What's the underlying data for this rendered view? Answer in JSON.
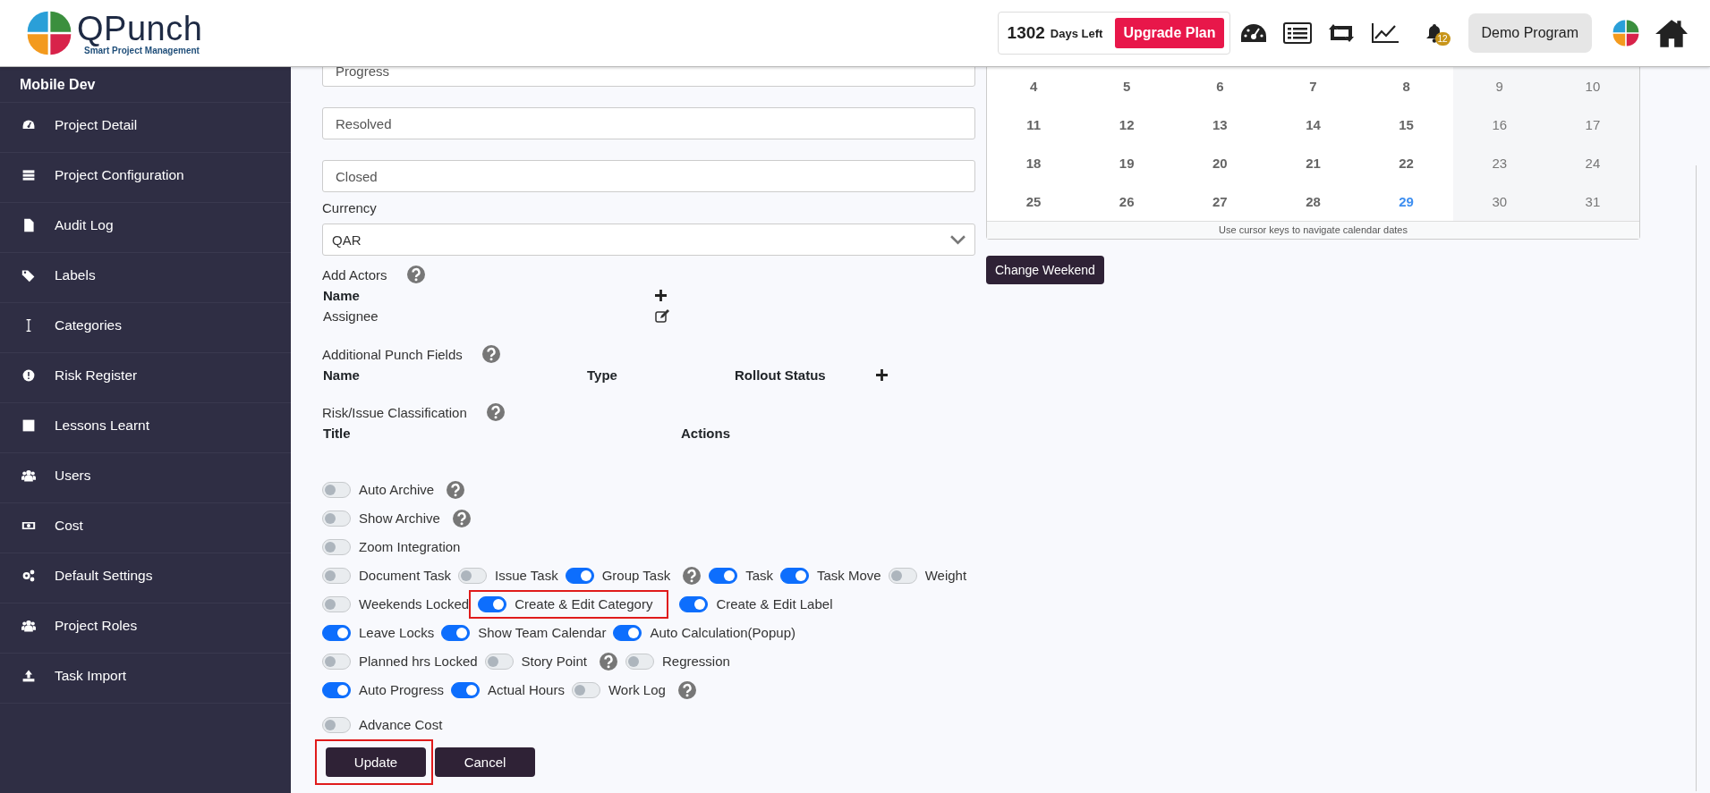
{
  "header": {
    "logo": {
      "name": "QPunch",
      "tagline": "Smart Project Management"
    },
    "days_left": {
      "count": "1302",
      "label": "Days Left"
    },
    "upgrade_button": "Upgrade Plan",
    "notification_badge": "12",
    "program_button": "Demo Program"
  },
  "sidebar": {
    "project": "Mobile Dev",
    "items": [
      {
        "label": "Project Detail"
      },
      {
        "label": "Project Configuration"
      },
      {
        "label": "Audit Log"
      },
      {
        "label": "Labels"
      },
      {
        "label": "Categories"
      },
      {
        "label": "Risk Register"
      },
      {
        "label": "Lessons Learnt"
      },
      {
        "label": "Users"
      },
      {
        "label": "Cost"
      },
      {
        "label": "Default Settings"
      },
      {
        "label": "Project Roles"
      },
      {
        "label": "Task Import"
      }
    ]
  },
  "form": {
    "status_fields": [
      "Progress",
      "Resolved",
      "Closed"
    ],
    "currency": {
      "label": "Currency",
      "value": "QAR"
    },
    "actors": {
      "title": "Add Actors",
      "column": "Name",
      "rows": [
        "Assignee"
      ]
    },
    "punch_fields": {
      "title": "Additional Punch Fields",
      "columns": [
        "Name",
        "Type",
        "Rollout Status"
      ]
    },
    "classification": {
      "title": "Risk/Issue Classification",
      "columns": [
        "Title",
        "Actions"
      ]
    },
    "toggle_rows": [
      [
        {
          "label": "Auto Archive",
          "on": false,
          "help": true,
          "highlighted": false
        }
      ],
      [
        {
          "label": "Show Archive",
          "on": false,
          "help": true,
          "highlighted": false
        }
      ],
      [
        {
          "label": "Zoom Integration",
          "on": false,
          "help": false,
          "highlighted": false
        }
      ],
      [
        {
          "label": "Document Task",
          "on": false,
          "help": false,
          "highlighted": false
        },
        {
          "label": "Issue Task",
          "on": false,
          "help": false,
          "highlighted": false
        },
        {
          "label": "Group Task",
          "on": true,
          "help": true,
          "highlighted": false
        },
        {
          "label": "Task",
          "on": true,
          "help": false,
          "highlighted": false
        },
        {
          "label": "Task Move",
          "on": true,
          "help": false,
          "highlighted": false
        },
        {
          "label": "Weight",
          "on": false,
          "help": false,
          "highlighted": false
        }
      ],
      [
        {
          "label": "Weekends Locked",
          "on": false,
          "help": false,
          "highlighted": false
        },
        {
          "label": "Create & Edit Category",
          "on": true,
          "help": false,
          "highlighted": true
        },
        {
          "label": "Create & Edit Label",
          "on": true,
          "help": false,
          "highlighted": false
        }
      ],
      [
        {
          "label": "Leave Locks",
          "on": true,
          "help": false,
          "highlighted": false
        },
        {
          "label": "Show Team Calendar",
          "on": true,
          "help": false,
          "highlighted": false
        },
        {
          "label": "Auto Calculation(Popup)",
          "on": true,
          "help": false,
          "highlighted": false
        }
      ],
      [
        {
          "label": "Planned hrs Locked",
          "on": false,
          "help": false,
          "highlighted": false
        },
        {
          "label": "Story Point",
          "on": false,
          "help": true,
          "highlighted": false
        },
        {
          "label": "Regression",
          "on": false,
          "help": false,
          "highlighted": false
        }
      ],
      [
        {
          "label": "Auto Progress",
          "on": true,
          "help": false,
          "highlighted": false
        },
        {
          "label": "Actual Hours",
          "on": true,
          "help": false,
          "highlighted": false
        },
        {
          "label": "Work Log",
          "on": false,
          "help": true,
          "highlighted": false
        }
      ],
      [
        {
          "label": "Advance Cost",
          "on": false,
          "help": false,
          "highlighted": false
        }
      ]
    ],
    "buttons": [
      {
        "label": "Update",
        "highlighted": true
      },
      {
        "label": "Cancel",
        "highlighted": false
      }
    ]
  },
  "calendar": {
    "weeks": [
      [
        {
          "day": "4",
          "weekend": false,
          "today": false
        },
        {
          "day": "5",
          "weekend": false,
          "today": false
        },
        {
          "day": "6",
          "weekend": false,
          "today": false
        },
        {
          "day": "7",
          "weekend": false,
          "today": false
        },
        {
          "day": "8",
          "weekend": false,
          "today": false
        },
        {
          "day": "9",
          "weekend": true,
          "today": false
        },
        {
          "day": "10",
          "weekend": true,
          "today": false
        }
      ],
      [
        {
          "day": "11",
          "weekend": false,
          "today": false
        },
        {
          "day": "12",
          "weekend": false,
          "today": false
        },
        {
          "day": "13",
          "weekend": false,
          "today": false
        },
        {
          "day": "14",
          "weekend": false,
          "today": false
        },
        {
          "day": "15",
          "weekend": false,
          "today": false
        },
        {
          "day": "16",
          "weekend": true,
          "today": false
        },
        {
          "day": "17",
          "weekend": true,
          "today": false
        }
      ],
      [
        {
          "day": "18",
          "weekend": false,
          "today": false
        },
        {
          "day": "19",
          "weekend": false,
          "today": false
        },
        {
          "day": "20",
          "weekend": false,
          "today": false
        },
        {
          "day": "21",
          "weekend": false,
          "today": false
        },
        {
          "day": "22",
          "weekend": false,
          "today": false
        },
        {
          "day": "23",
          "weekend": true,
          "today": false
        },
        {
          "day": "24",
          "weekend": true,
          "today": false
        }
      ],
      [
        {
          "day": "25",
          "weekend": false,
          "today": false
        },
        {
          "day": "26",
          "weekend": false,
          "today": false
        },
        {
          "day": "27",
          "weekend": false,
          "today": false
        },
        {
          "day": "28",
          "weekend": false,
          "today": false
        },
        {
          "day": "29",
          "weekend": false,
          "today": true
        },
        {
          "day": "30",
          "weekend": true,
          "today": false
        },
        {
          "day": "31",
          "weekend": true,
          "today": false
        }
      ]
    ],
    "hint": "Use cursor keys to navigate calendar dates",
    "change_weekend_button": "Change Weekend"
  }
}
